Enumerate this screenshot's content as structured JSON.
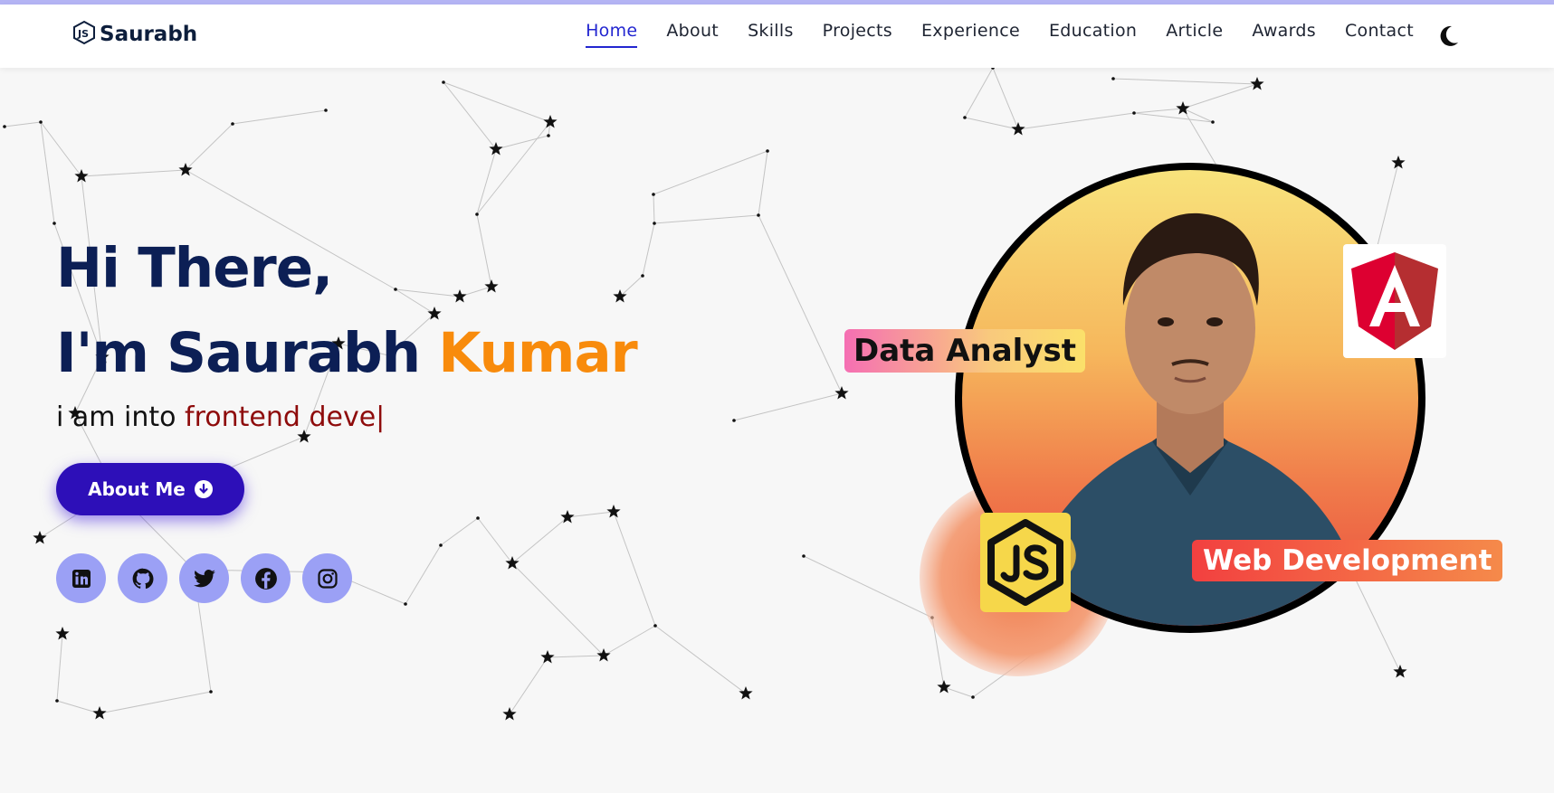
{
  "brand": {
    "name": "Saurabh",
    "logo_icon": "js-hex-icon"
  },
  "nav": {
    "items": [
      {
        "label": "Home",
        "active": true
      },
      {
        "label": "About"
      },
      {
        "label": "Skills"
      },
      {
        "label": "Projects"
      },
      {
        "label": "Experience"
      },
      {
        "label": "Education"
      },
      {
        "label": "Article"
      },
      {
        "label": "Awards"
      },
      {
        "label": "Contact"
      }
    ],
    "theme_toggle_icon": "moon-icon"
  },
  "hero": {
    "greeting": "Hi There,",
    "intro_prefix": "I'm Saurabh ",
    "intro_accent": "Kumar",
    "typed_prefix": "i am into ",
    "typed_text": "frontend deve",
    "cursor": "|",
    "about_button_label": "About Me",
    "about_button_icon": "arrow-down-circle-icon"
  },
  "socials": [
    {
      "name": "linkedin-icon"
    },
    {
      "name": "github-icon"
    },
    {
      "name": "twitter-icon"
    },
    {
      "name": "facebook-icon"
    },
    {
      "name": "instagram-icon"
    }
  ],
  "profile": {
    "tags": {
      "data_analyst": "Data Analyst",
      "web_development": "Web Development"
    },
    "badges": [
      "javascript-icon",
      "angular-icon"
    ]
  },
  "colors": {
    "primary": "#2d0fb8",
    "heading": "#0c1f55",
    "accent": "#f88b0c",
    "typed": "#8e0b0b",
    "nav_active": "#2326d0",
    "social_bg": "#9ba0f5"
  }
}
